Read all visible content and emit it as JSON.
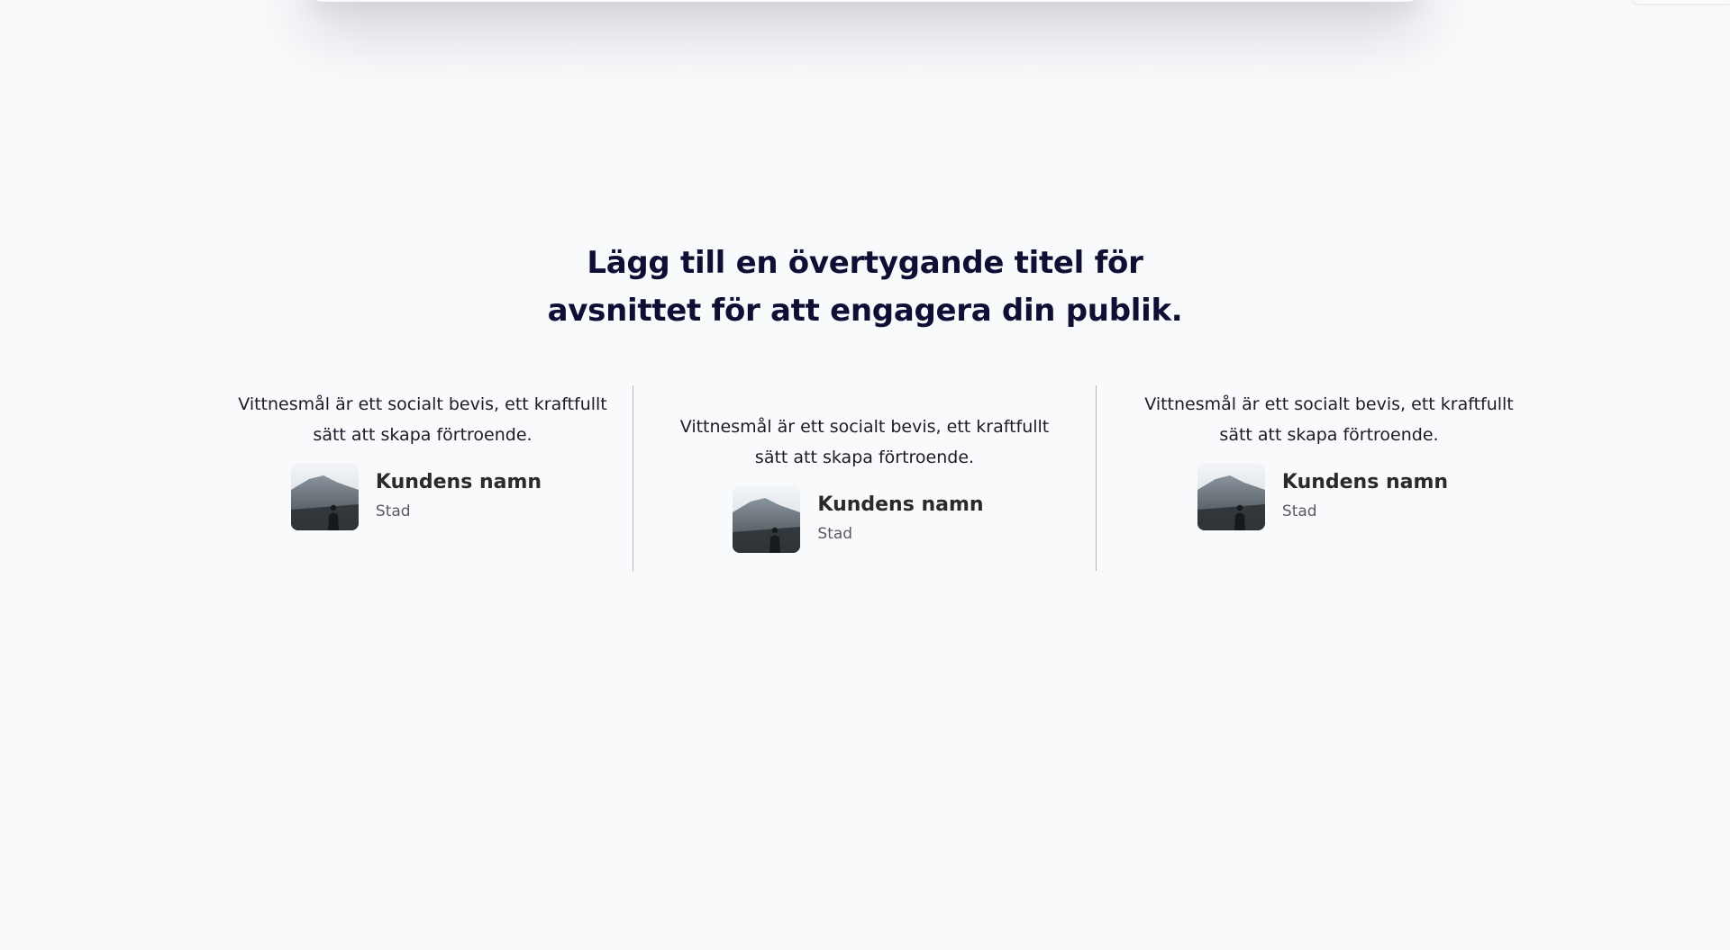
{
  "section": {
    "title": "Lägg till en övertygande titel för avsnittet för att engagera din publik."
  },
  "testimonials": [
    {
      "quote": "Vittnesmål är ett socialt bevis, ett kraftfullt sätt att skapa förtroende.",
      "name": "Kundens namn",
      "city": "Stad"
    },
    {
      "quote": "Vittnesmål är ett socialt bevis, ett kraftfullt sätt att skapa förtroende.",
      "name": "Kundens namn",
      "city": "Stad"
    },
    {
      "quote": "Vittnesmål är ett socialt bevis, ett kraftfullt sätt att skapa förtroende.",
      "name": "Kundens namn",
      "city": "Stad"
    }
  ],
  "colors": {
    "background": "#f9fafc",
    "title": "#0f0f35",
    "text": "#1c1c28",
    "name": "#2a2a2a",
    "city": "#5a5a60",
    "divider": "#b8b8bd"
  },
  "icons": {
    "avatar": "mountain-person-photo"
  }
}
